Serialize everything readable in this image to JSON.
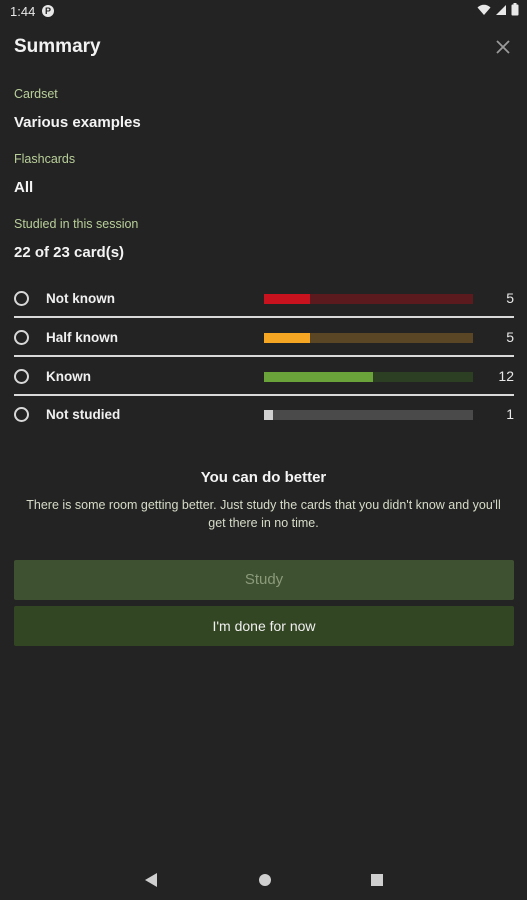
{
  "status_bar": {
    "time": "1:44",
    "app_icon": "P"
  },
  "header": {
    "title": "Summary"
  },
  "fields": {
    "cardset_label": "Cardset",
    "cardset_value": "Various examples",
    "flashcards_label": "Flashcards",
    "flashcards_value": "All",
    "studied_label": "Studied in this session",
    "studied_value": "22 of 23 card(s)"
  },
  "categories": [
    {
      "label": "Not known",
      "count": "5",
      "fraction": 0.22,
      "fill_color": "#c8121e",
      "track_color": "#5a1a1e"
    },
    {
      "label": "Half known",
      "count": "5",
      "fraction": 0.22,
      "fill_color": "#f5a623",
      "track_color": "#5a4524"
    },
    {
      "label": "Known",
      "count": "12",
      "fraction": 0.52,
      "fill_color": "#6aa339",
      "track_color": "#2c3f22"
    },
    {
      "label": "Not studied",
      "count": "1",
      "fraction": 0.045,
      "fill_color": "#d2d2d2",
      "track_color": "#4a4a4a"
    }
  ],
  "message": {
    "title": "You can do better",
    "body": "There is some room getting better. Just study the cards that you didn't know and you'll get there in no time."
  },
  "buttons": {
    "study": "Study",
    "done": "I'm done for now"
  },
  "colors": {
    "background": "#232323",
    "label_accent": "#b9cf9a",
    "study_button": "#3e5130",
    "done_button": "#334623"
  }
}
